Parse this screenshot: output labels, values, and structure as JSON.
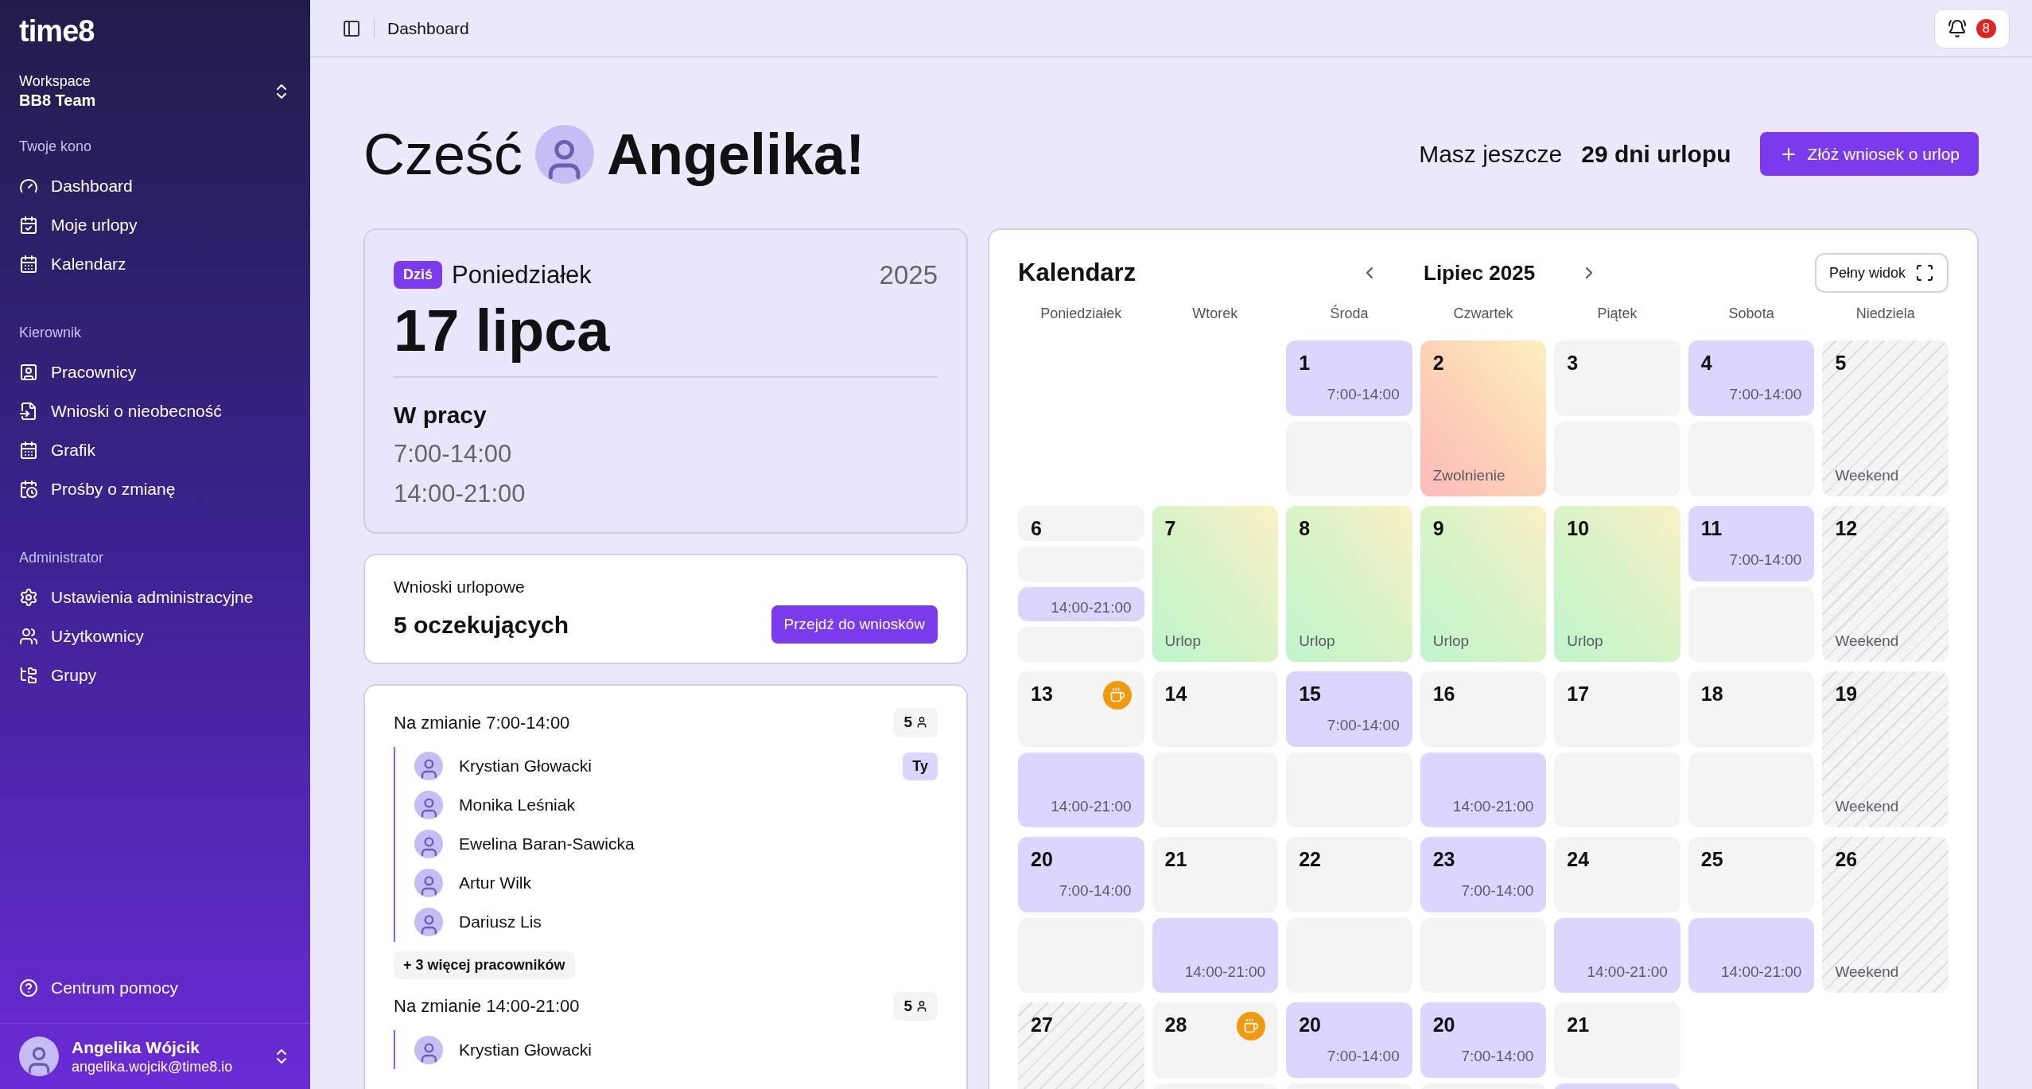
{
  "sidebar": {
    "logo": "time8",
    "workspace": {
      "label": "Workspace",
      "name": "BB8 Team"
    },
    "sections": [
      {
        "title": "Twoje kono",
        "items": [
          "Dashboard",
          "Moje urlopy",
          "Kalendarz"
        ]
      },
      {
        "title": "Kierownik",
        "items": [
          "Pracownicy",
          "Wnioski o nieobecność",
          "Grafik",
          "Prośby o zmianę"
        ]
      },
      {
        "title": "Administrator",
        "items": [
          "Ustawienia administracyjne",
          "Użytkownicy",
          "Grupy"
        ]
      }
    ],
    "help": "Centrum pomocy",
    "user": {
      "name": "Angelika Wójcik",
      "email": "angelika.wojcik@time8.io"
    }
  },
  "topbar": {
    "breadcrumb": "Dashboard",
    "notifications": "8"
  },
  "greeting": {
    "hello": "Cześć",
    "name": "Angelika!",
    "remaining_label": "Masz jeszcze",
    "remaining_value": "29 dni urlopu",
    "cta": "Złóż wniosek o urlop"
  },
  "today": {
    "badge": "Dziś",
    "weekday": "Poniedziałek",
    "year": "2025",
    "date": "17 lipca",
    "status": "W pracy",
    "shifts": [
      "7:00-14:00",
      "14:00-21:00"
    ]
  },
  "requests": {
    "title": "Wnioski urlopowe",
    "count": "5 oczekujących",
    "button": "Przejdź do wniosków"
  },
  "shifts": [
    {
      "title": "Na zmianie 7:00-14:00",
      "count": "5",
      "people": [
        {
          "name": "Krystian Głowacki",
          "tag": "Ty"
        },
        {
          "name": "Monika Leśniak"
        },
        {
          "name": "Ewelina Baran-Sawicka"
        },
        {
          "name": "Artur Wilk"
        },
        {
          "name": "Dariusz Lis"
        }
      ],
      "more": "+ 3 więcej pracowników"
    },
    {
      "title": "Na zmianie 14:00-21:00",
      "count": "5",
      "people": [
        {
          "name": "Krystian Głowacki"
        }
      ]
    }
  ],
  "calendar": {
    "title": "Kalendarz",
    "month": "Lipiec 2025",
    "full_view": "Pełny widok",
    "weekdays": [
      "Poniedziałek",
      "Wtorek",
      "Środa",
      "Czwartek",
      "Piątek",
      "Sobota",
      "Niedziela"
    ],
    "days": [
      {
        "kind": "blank"
      },
      {
        "kind": "blank"
      },
      {
        "kind": "shift",
        "day": "1",
        "segments": [
          {
            "on": true,
            "text": "7:00-14:00"
          },
          {
            "on": false
          }
        ]
      },
      {
        "kind": "sick",
        "day": "2",
        "text": "Zwolnienie"
      },
      {
        "kind": "shift",
        "day": "3",
        "segments": [
          {
            "on": false
          },
          {
            "on": false
          }
        ]
      },
      {
        "kind": "shift",
        "day": "4",
        "segments": [
          {
            "on": true,
            "text": "7:00-14:00"
          },
          {
            "on": false
          }
        ]
      },
      {
        "kind": "weekend",
        "day": "5",
        "text": "Weekend"
      },
      {
        "kind": "shift",
        "day": "6",
        "segments": [
          {
            "on": false
          },
          {
            "on": false
          },
          {
            "on": true,
            "text": "14:00-21:00"
          },
          {
            "on": false
          }
        ]
      },
      {
        "kind": "leave",
        "day": "7",
        "text": "Urlop"
      },
      {
        "kind": "leave",
        "day": "8",
        "text": "Urlop"
      },
      {
        "kind": "leave",
        "day": "9",
        "text": "Urlop"
      },
      {
        "kind": "leave",
        "day": "10",
        "text": "Urlop"
      },
      {
        "kind": "shift",
        "day": "11",
        "segments": [
          {
            "on": true,
            "text": "7:00-14:00"
          },
          {
            "on": false
          }
        ]
      },
      {
        "kind": "weekend",
        "day": "12",
        "text": "Weekend"
      },
      {
        "kind": "shift",
        "day": "13",
        "coffee": true,
        "segments": [
          {
            "on": false
          },
          {
            "on": true,
            "text": "14:00-21:00"
          }
        ]
      },
      {
        "kind": "shift",
        "day": "14",
        "segments": [
          {
            "on": false
          },
          {
            "on": false
          }
        ]
      },
      {
        "kind": "shift",
        "day": "15",
        "segments": [
          {
            "on": true,
            "text": "7:00-14:00"
          },
          {
            "on": false
          }
        ]
      },
      {
        "kind": "shift",
        "day": "16",
        "segments": [
          {
            "on": false
          },
          {
            "on": true,
            "text": "14:00-21:00"
          }
        ]
      },
      {
        "kind": "shift",
        "day": "17",
        "segments": [
          {
            "on": false
          },
          {
            "on": false
          }
        ]
      },
      {
        "kind": "shift",
        "day": "18",
        "segments": [
          {
            "on": false
          },
          {
            "on": false
          }
        ]
      },
      {
        "kind": "weekend",
        "day": "19",
        "text": "Weekend"
      },
      {
        "kind": "shift",
        "day": "20",
        "segments": [
          {
            "on": true,
            "text": "7:00-14:00"
          },
          {
            "on": false
          }
        ]
      },
      {
        "kind": "shift",
        "day": "21",
        "segments": [
          {
            "on": false
          },
          {
            "on": true,
            "text": "14:00-21:00"
          }
        ]
      },
      {
        "kind": "shift",
        "day": "22",
        "segments": [
          {
            "on": false
          },
          {
            "on": false
          }
        ]
      },
      {
        "kind": "shift",
        "day": "23",
        "segments": [
          {
            "on": true,
            "text": "7:00-14:00"
          },
          {
            "on": false
          }
        ]
      },
      {
        "kind": "shift",
        "day": "24",
        "segments": [
          {
            "on": false
          },
          {
            "on": true,
            "text": "14:00-21:00"
          }
        ]
      },
      {
        "kind": "shift",
        "day": "25",
        "segments": [
          {
            "on": false
          },
          {
            "on": true,
            "text": "14:00-21:00"
          }
        ]
      },
      {
        "kind": "weekend",
        "day": "26",
        "text": "Weekend"
      },
      {
        "kind": "weekend",
        "day": "27"
      },
      {
        "kind": "shift",
        "day": "28",
        "coffee": true,
        "segments": [
          {
            "on": false
          },
          {
            "on": false
          }
        ]
      },
      {
        "kind": "shift",
        "day": "20",
        "segments": [
          {
            "on": true,
            "text": "7:00-14:00"
          },
          {
            "on": false
          }
        ]
      },
      {
        "kind": "shift",
        "day": "20",
        "segments": [
          {
            "on": true,
            "text": "7:00-14:00"
          },
          {
            "on": false
          }
        ]
      },
      {
        "kind": "shift",
        "day": "21",
        "segments": [
          {
            "on": false
          },
          {
            "on": true
          }
        ]
      }
    ]
  }
}
